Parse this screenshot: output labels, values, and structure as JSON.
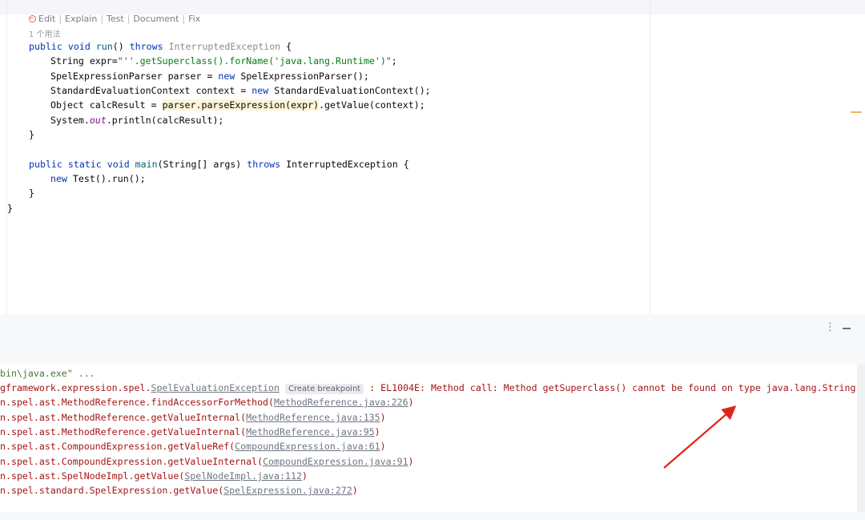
{
  "editor": {
    "codelens": {
      "items": [
        "Edit",
        "Explain",
        "Test",
        "Document",
        "Fix"
      ],
      "separator": "|"
    },
    "usages": "1 个用法",
    "code": {
      "l1": {
        "kw1": "public",
        "kw2": "void",
        "fn": "run",
        "p1": "() ",
        "kw3": "throws",
        "exc": "InterruptedException",
        "brace": " {"
      },
      "l2": {
        "a": "String expr=",
        "str": "\"''.getSuperclass().forName('java.lang.Runtime')\"",
        "b": ";"
      },
      "l3": {
        "a": "SpelExpressionParser parser = ",
        "kw": "new",
        "b": " SpelExpressionParser();"
      },
      "l4": {
        "a": "StandardEvaluationContext context = ",
        "kw": "new",
        "b": " StandardEvaluationContext();"
      },
      "l5": {
        "a": "Object calcResult = ",
        "hl": "parser.parseExpression(expr)",
        "b": ".getValue(context);"
      },
      "l6": {
        "a": "System.",
        "field": "out",
        "b": ".println(calcResult);"
      },
      "l7": "}",
      "l8": {
        "kw1": "public",
        "kw2": "static",
        "kw3": "void",
        "fn": "main",
        "p1": "(String[] args) ",
        "kw4": "throws",
        "b": " InterruptedException {"
      },
      "l9": {
        "kw": "new",
        "b": " Test().run();"
      },
      "l10": "}",
      "l11": "}"
    }
  },
  "run_panel": {
    "more_icon": "⋮",
    "console": {
      "cmd": "bin\\java.exe\" ...",
      "exception": {
        "prefix": "gframework.expression.spel.",
        "link": "SpelEvaluationException",
        "hint": "Create breakpoint",
        "message": " : EL1004E: Method call: Method getSuperclass() cannot be found on type java.lang.String"
      },
      "stack": [
        {
          "text": "n.spel.ast.MethodReference.findAccessorForMethod(",
          "link": "MethodReference.java:226",
          "end": ")"
        },
        {
          "text": "n.spel.ast.MethodReference.getValueInternal(",
          "link": "MethodReference.java:135",
          "end": ")"
        },
        {
          "text": "n.spel.ast.MethodReference.getValueInternal(",
          "link": "MethodReference.java:95",
          "end": ")"
        },
        {
          "text": "n.spel.ast.CompoundExpression.getValueRef(",
          "link": "CompoundExpression.java:61",
          "end": ")"
        },
        {
          "text": "n.spel.ast.CompoundExpression.getValueInternal(",
          "link": "CompoundExpression.java:91",
          "end": ")"
        },
        {
          "text": "n.spel.ast.SpelNodeImpl.getValue(",
          "link": "SpelNodeImpl.java:112",
          "end": ")"
        },
        {
          "text": "n.spel.standard.SpelExpression.getValue(",
          "link": "SpelExpression.java:272",
          "end": ")"
        }
      ]
    }
  },
  "annotation": {
    "arrow_color": "#e0241b"
  }
}
